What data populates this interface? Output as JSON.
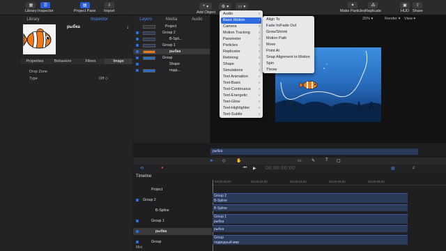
{
  "toolbar": {
    "library": "Library",
    "inspector": "Inspector",
    "project_pane": "Project Pane",
    "import": "Import",
    "add_object": "Add Object",
    "make_particles": "Make Particles",
    "replicate": "Replicate",
    "hud": "HUD",
    "share": "Share"
  },
  "left": {
    "tab_library": "Library",
    "tab_inspector": "Inspector",
    "item_name": "рыбка",
    "subtabs": [
      "Properties",
      "Behaviors",
      "Filters",
      "Image"
    ],
    "drop_zone": "Drop Zone",
    "type_label": "Type",
    "type_value": "Off ◇"
  },
  "layers": {
    "tabs": [
      "Layers",
      "Media",
      "Audio"
    ],
    "rows": [
      {
        "label": "Project"
      },
      {
        "label": "Group 2"
      },
      {
        "label": "B-Spli..."
      },
      {
        "label": "Group 1"
      },
      {
        "label": "рыбка"
      },
      {
        "label": "Group"
      },
      {
        "label": "Shape"
      },
      {
        "label": "пода..."
      }
    ]
  },
  "canvas": {
    "zoom": "25% ▾",
    "render": "Render ▾",
    "view": "View ▾",
    "mini_label": "рыбка"
  },
  "menu_behaviors": {
    "items": [
      "Audio",
      "Basic Motion",
      "Camera",
      "Motion Tracking",
      "Parameter",
      "Particles",
      "Replicator",
      "Retiming",
      "Shape",
      "Simulations",
      "Text Animation",
      "Text-Basic",
      "Text-Continuous",
      "Text-Energetic",
      "Text-Glow",
      "Text-Highlighter",
      "Text-Subtle"
    ]
  },
  "menu_basic": {
    "items": [
      "Align To",
      "Fade In/Fade Out",
      "Grow/Shrink",
      "Motion Path",
      "Move",
      "Point At",
      "Snap Alignment to Motion",
      "Spin",
      "Throw"
    ]
  },
  "transport": {
    "timecode": "00:00:00:00"
  },
  "timeline": {
    "title": "Timeline",
    "rows": [
      "Project",
      "Group 2",
      "B-Spline",
      "Group 1",
      "рыбка",
      "Group"
    ],
    "ruler": [
      "00:00:00:00",
      "00:00:02:00",
      "00:00:04:00",
      "00:00:06:00",
      "00:00:08:00"
    ],
    "bars": [
      {
        "title": "Group 2",
        "sub": "B-Spline"
      },
      {
        "title": "B-Spline"
      },
      {
        "title": "Group 1",
        "sub": "рыбка"
      },
      {
        "title": "рыбка"
      },
      {
        "title": "Group",
        "sub": "подводный мир"
      }
    ],
    "mini": "Mini"
  },
  "colors": {
    "accent": "#2f6be0",
    "menu_bg": "#e8e8ea",
    "scene_top": "#3d8fe0",
    "scene_bottom": "#0d2f60"
  }
}
